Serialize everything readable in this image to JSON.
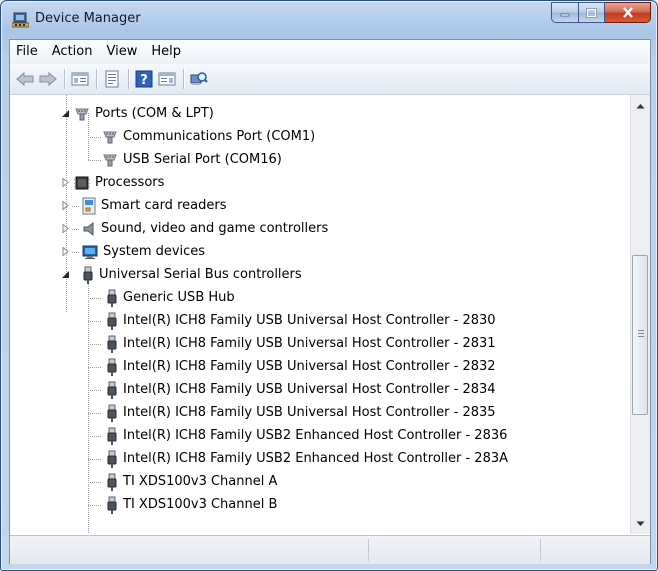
{
  "window": {
    "title": "Device Manager"
  },
  "menu": [
    "File",
    "Action",
    "View",
    "Help"
  ],
  "toolbar": [
    "back-icon",
    "forward-icon",
    "show-hide-tree-icon",
    "properties-icon",
    "help-icon",
    "action-pane-icon",
    "scan-hardware-icon"
  ],
  "tree": {
    "ports": {
      "label": "Ports (COM & LPT)",
      "children": [
        "Communications Port (COM1)",
        "USB Serial Port (COM16)"
      ]
    },
    "processors": "Processors",
    "smart_card": "Smart card readers",
    "sound": "Sound, video and game controllers",
    "system": "System devices",
    "usb": {
      "label": "Universal Serial Bus controllers",
      "children": [
        "Generic USB Hub",
        "Intel(R) ICH8 Family USB Universal Host Controller - 2830",
        "Intel(R) ICH8 Family USB Universal Host Controller - 2831",
        "Intel(R) ICH8 Family USB Universal Host Controller - 2832",
        "Intel(R) ICH8 Family USB Universal Host Controller - 2834",
        "Intel(R) ICH8 Family USB Universal Host Controller - 2835",
        "Intel(R) ICH8 Family USB2 Enhanced Host Controller - 2836",
        "Intel(R) ICH8 Family USB2 Enhanced Host Controller - 283A",
        "TI XDS100v3 Channel A",
        "TI XDS100v3 Channel B"
      ]
    }
  }
}
